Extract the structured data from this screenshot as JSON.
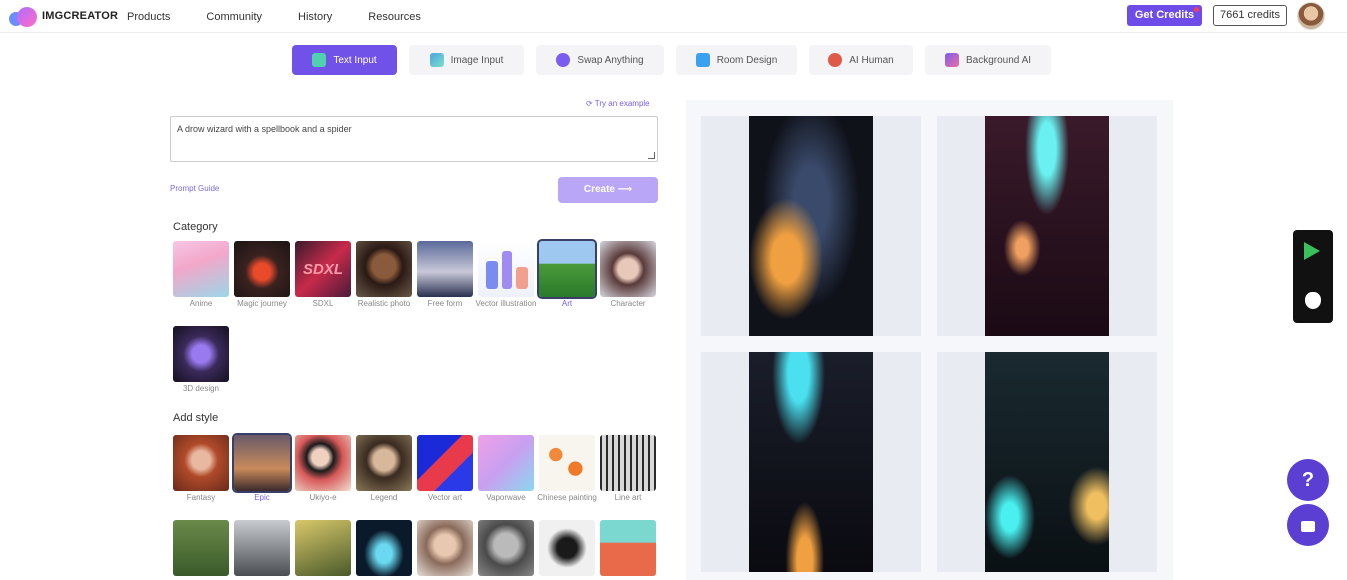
{
  "brand": {
    "name": "IMGCREATOR"
  },
  "nav": [
    "Products",
    "Community",
    "History",
    "Resources"
  ],
  "header": {
    "get_credits": "Get Credits",
    "credits": "7661 credits"
  },
  "tabs": [
    {
      "label": "Text Input",
      "icon": "text-icon"
    },
    {
      "label": "Image Input",
      "icon": "image-icon"
    },
    {
      "label": "Swap Anything",
      "icon": "swap-icon"
    },
    {
      "label": "Room Design",
      "icon": "home-icon"
    },
    {
      "label": "AI Human",
      "icon": "human-icon"
    },
    {
      "label": "Background AI",
      "icon": "background-icon"
    }
  ],
  "prompt": {
    "try_example": "Try an example",
    "value": "A drow wizard with a spellbook and a spider",
    "guide": "Prompt Guide",
    "create": "Create"
  },
  "category": {
    "title": "Category",
    "items": [
      "Anime",
      "Magic journey",
      "SDXL",
      "Realistic photo",
      "Free form",
      "Vector illustration",
      "Art",
      "Character",
      "3D design"
    ],
    "selected": "Art"
  },
  "style": {
    "title": "Add style",
    "items": [
      "Fantasy",
      "Epic",
      "Ukiyo-e",
      "Legend",
      "Vector art",
      "Vaporwave",
      "Chinese painting",
      "Line art"
    ],
    "selected": "Epic"
  },
  "sdxl_text": "SDXL",
  "colors": {
    "accent": "#7052e8",
    "accent_light": "#b9a6f7",
    "gallery_bg": "#f6f7fb"
  }
}
